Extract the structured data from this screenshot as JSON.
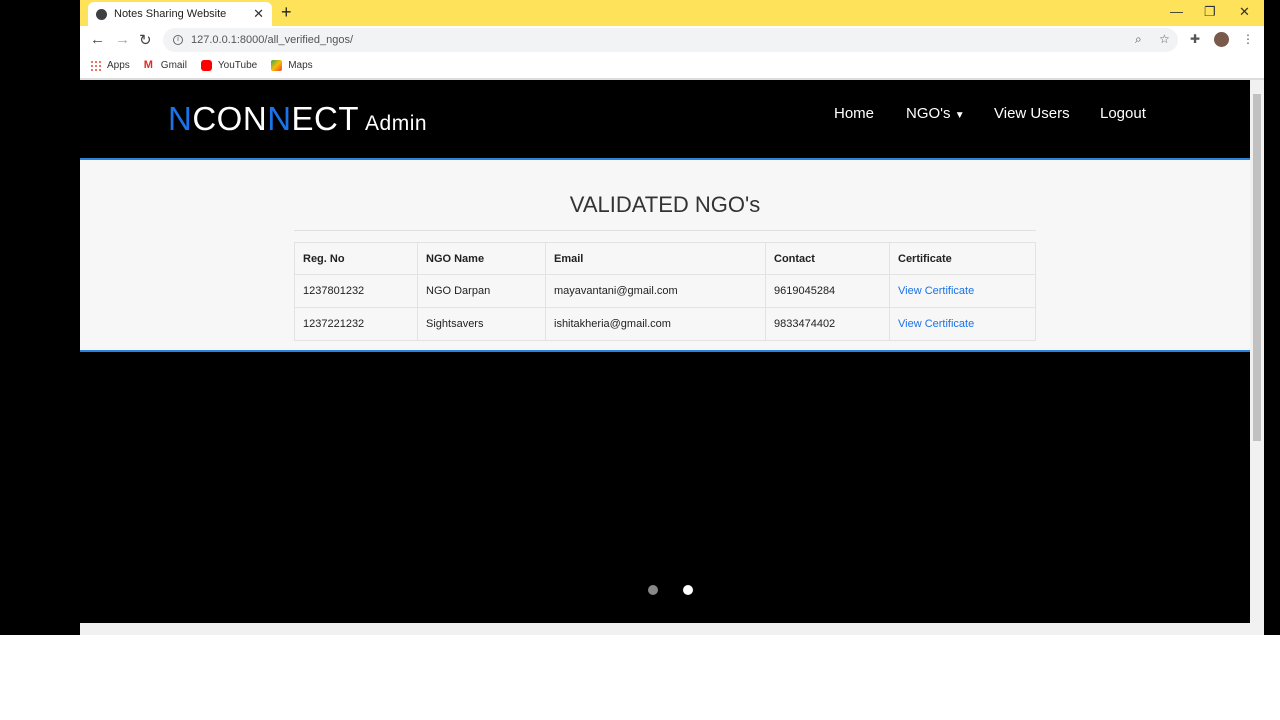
{
  "browser": {
    "tab_title": "Notes Sharing Website",
    "url": "127.0.0.1:8000/all_verified_ngos/",
    "bookmarks": [
      {
        "label": "Apps",
        "icon": "apps-grid-icon",
        "color": "#ea4335"
      },
      {
        "label": "Gmail",
        "icon": "gmail-icon",
        "color": "#d93025"
      },
      {
        "label": "YouTube",
        "icon": "youtube-icon",
        "color": "#ff0000"
      },
      {
        "label": "Maps",
        "icon": "maps-icon",
        "color": "#34a853"
      }
    ]
  },
  "site": {
    "brand_n1": "N",
    "brand_con": "CON",
    "brand_n2": "N",
    "brand_ect": "ECT",
    "brand_admin": "Admin",
    "accent_color": "#1a73e8",
    "nav": [
      {
        "label": "Home"
      },
      {
        "label": "NGO's"
      },
      {
        "label": "View Users"
      },
      {
        "label": "Logout"
      }
    ]
  },
  "main": {
    "title": "VALIDATED NGO's",
    "columns": [
      "Reg. No",
      "NGO Name",
      "Email",
      "Contact",
      "Certificate"
    ],
    "rows": [
      [
        "1237801232",
        "NGO Darpan",
        "mayavantani@gmail.com",
        "9619045284",
        "View Certificate"
      ],
      [
        "1237221232",
        "Sightsavers",
        "ishitakheria@gmail.com",
        "9833474402",
        "View Certificate"
      ]
    ]
  },
  "carousel": {
    "active_index": 1,
    "count": 2
  }
}
